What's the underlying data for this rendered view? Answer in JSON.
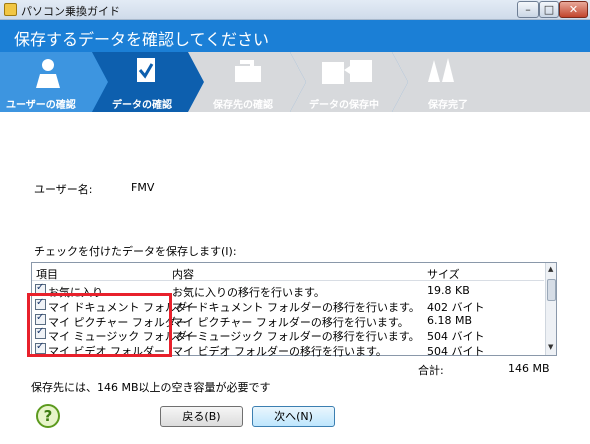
{
  "window": {
    "title": "パソコン乗換ガイド",
    "min_label": "–",
    "max_label": "□",
    "close_label": "✕"
  },
  "header": {
    "title": "保存するデータを確認してください"
  },
  "steps": [
    {
      "label": "ユーザーの確認",
      "state": "done"
    },
    {
      "label": "データの確認",
      "state": "current"
    },
    {
      "label": "保存先の確認",
      "state": "pending"
    },
    {
      "label": "データの保存中",
      "state": "pending"
    },
    {
      "label": "保存完了",
      "state": "pending"
    }
  ],
  "user": {
    "label": "ユーザー名:",
    "value": "FMV"
  },
  "list": {
    "caption": "チェックを付けたデータを保存します(I):",
    "columns": {
      "item": "項目",
      "content": "内容",
      "size": "サイズ"
    },
    "rows": [
      {
        "name": "お気に入り",
        "desc": "お気に入りの移行を行います。",
        "size": "19.8 KB",
        "checked": true
      },
      {
        "name": "マイ ドキュメント フォルダー",
        "desc": "マイ ドキュメント フォルダーの移行を行います。",
        "size": "402 バイト",
        "checked": true
      },
      {
        "name": "マイ ピクチャー フォルダー",
        "desc": "マイ ピクチャー フォルダーの移行を行います。",
        "size": "6.18 MB",
        "checked": true
      },
      {
        "name": "マイ ミュージック フォルダー",
        "desc": "マイ ミュージック フォルダーの移行を行います。",
        "size": "504 バイト",
        "checked": true
      },
      {
        "name": "マイ ビデオ フォルダー",
        "desc": "マイ ビデオ フォルダーの移行を行います。",
        "size": "504 バイト",
        "checked": true
      }
    ]
  },
  "total": {
    "label": "合計:",
    "value": "146 MB"
  },
  "space_note": "保存先には、146 MB以上の空き容量が必要です",
  "buttons": {
    "help": "?",
    "back": "戻る(B)",
    "next": "次へ(N)"
  },
  "colors": {
    "accent": "#1b7fd6",
    "highlight": "#e8202b"
  },
  "icons": [
    "person-icon",
    "document-check-icon",
    "folder-save-icon",
    "copy-icon",
    "celebrate-hands-icon"
  ]
}
